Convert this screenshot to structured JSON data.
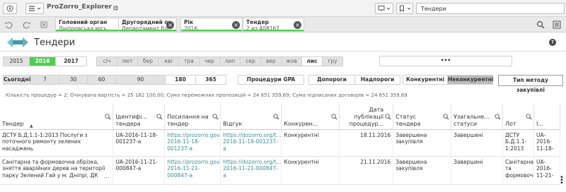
{
  "toolbar": {
    "app_name": "ProZorro_Explorer",
    "sheet": "Тендери"
  },
  "selections": [
    {
      "title": "Головний орган",
      "value": "Дніпровська місь..."
    },
    {
      "title": "Другорядний ор...",
      "value": "Департамент бла..."
    },
    {
      "title": "Рік",
      "value": "2016"
    },
    {
      "title": "Тендер",
      "value": "2 из 408167"
    }
  ],
  "page": {
    "title": "Тендери",
    "help": "?"
  },
  "years": [
    "2015",
    "2016",
    "2017"
  ],
  "months": [
    "січ",
    "лют",
    "бер",
    "кві",
    "тра",
    "чер",
    "лип",
    "сер",
    "вер",
    "жов",
    "лис",
    "гру"
  ],
  "search_box": "•••",
  "periods": [
    "Сьогодні",
    "7",
    "30",
    "60",
    "90",
    "180",
    "365"
  ],
  "procedures_gpa": "Процедури GPA",
  "thresholds": [
    "Допороги",
    "Надпороги"
  ],
  "competition": [
    "Конкурентні",
    "Неконкурентні"
  ],
  "method_type": "Тип методу закупівлі",
  "info_line": "Кількість процедур = 2; Очікувана вартість = 25 182 100,00; Сума переможних пропозицій = 24 651 359,69; Сума підписаних договорів = 24 651 359,69",
  "columns": [
    "Тендер",
    "Ідентифі... тендера",
    "Посилання на тендер",
    "Відгук",
    "Конкурен...",
    "Дата публікації процедур...",
    "Статус тендера",
    "Узагальне... статуси",
    "Лот",
    "І..."
  ],
  "rows": [
    {
      "tender": "ДСТУ Б.Д.1.1-1:2013 Послуги з поточного ремонту зелених насаджень",
      "id": "UA-2016-11-18-001237-a",
      "link": "https://prozorro.gov... 2016-11-18-001237-a",
      "feedback": "https://dozorro.org/t... 2016-11-18-001237-a",
      "competitive": "Конкурентні",
      "date": "18.11.2016",
      "status": "Завершена закупівля",
      "general": "Завершені",
      "lot": "ДСТУ Б.Д.1.1-1:2013",
      "last": "UA-2016-11-18-"
    },
    {
      "tender": "Санітарна та формовочна обрізка, зняття аварійних дерев на території парку Зелений Гай у м. Дніпрі, ДК",
      "id": "UA-2016-11-21-000847-a",
      "link": "https://prozorro.gov... 2016-11-21-000847-a",
      "feedback": "https://dozorro.org/t... 2016-11-21-000847-a",
      "competitive": "Конкурентні",
      "date": "21.11.2016",
      "status": "Завершена закупівля",
      "general": "Завершені",
      "lot": "Санітарна та формовочна",
      "last": "UA-2016-11-21-"
    }
  ],
  "ellipsis": "..."
}
